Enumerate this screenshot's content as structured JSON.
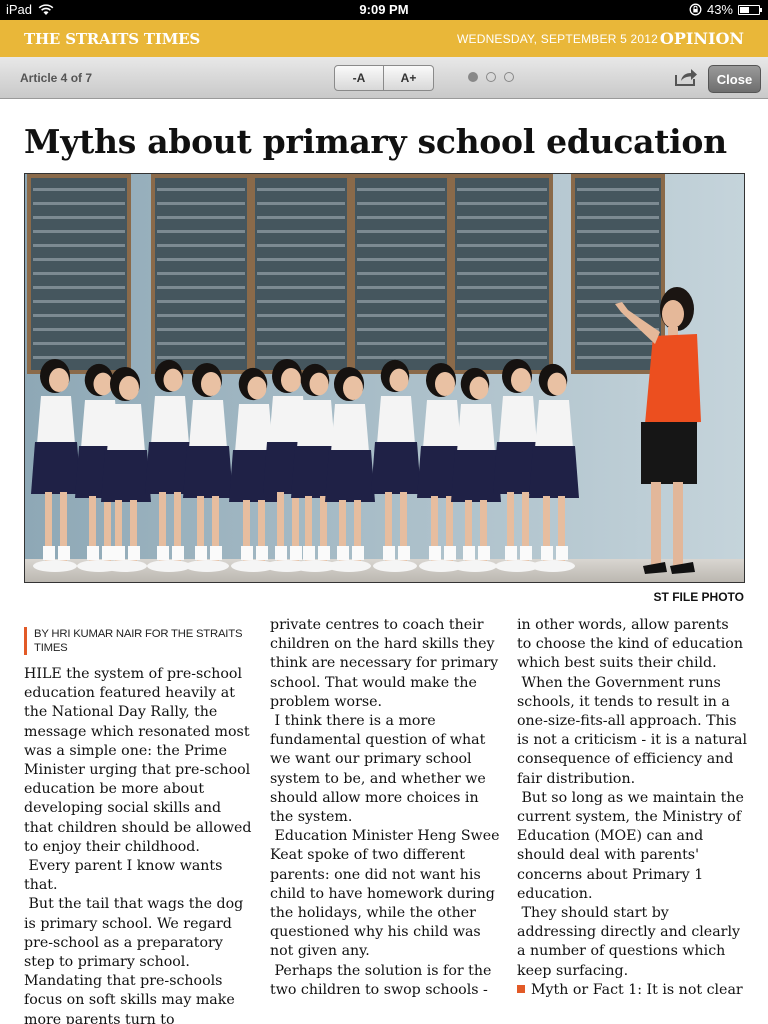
{
  "status_bar": {
    "device": "iPad",
    "time": "9:09 PM",
    "battery": "43%",
    "battery_level": 0.43
  },
  "masthead": {
    "brand": "THE STRAITS TIMES",
    "date": "WEDNESDAY, SEPTEMBER 5 2012",
    "section": "OPINION",
    "color": "#e9b739"
  },
  "toolbar": {
    "article_count": "Article 4 of 7",
    "font_decrease": "-A",
    "font_increase": "A+",
    "close": "Close",
    "page_dots": 3,
    "active_dot": 0
  },
  "article": {
    "headline": "Myths about primary school education",
    "photo_credit": "ST FILE PHOTO",
    "byline": "BY HRI KUMAR NAIR FOR THE STRAITS TIMES",
    "accent_color": "#e25a27",
    "col1": [
      "HILE the system of pre-school education featured heavily at the National Day Rally, the message which resonated most was a simple one: the Prime Minister urging that pre-school education be more about developing social skills and that children should be allowed to enjoy their childhood.",
      " Every parent I know wants that.",
      " But the tail that wags the dog is primary school. We regard pre-school as a preparatory step to primary school. Mandating that pre-schools focus on soft skills may make more parents turn to"
    ],
    "col2": [
      "private centres to coach their children on the hard skills they think are necessary for primary school. That would make the problem worse.",
      " I think there is a more fundamental question of what we want our primary school system to be, and whether we should allow more choices in the system.",
      " Education Minister Heng Swee Keat spoke of two different parents: one did not want his child to have homework during the holidays, while the other questioned why his child was not given any.",
      " Perhaps the solution is for the two children to swop schools -"
    ],
    "col3": [
      "in other words, allow parents to choose the kind of education which best suits their child.",
      " When the Government runs schools, it tends to result in a one-size-fits-all approach. This is not a criticism - it is a natural consequence of efficiency and fair distribution.",
      " But so long as we maintain the current system, the Ministry of Education (MOE) can and should deal with parents' concerns about Primary 1 education.",
      " They should start by addressing directly and clearly a number of questions which keep surfacing."
    ],
    "col3_last": "Myth or Fact 1: It is not clear"
  }
}
